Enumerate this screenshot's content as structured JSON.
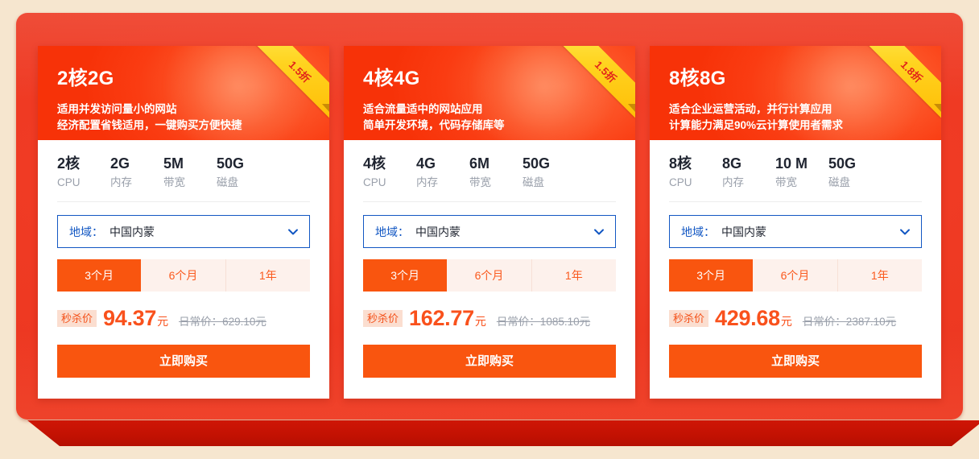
{
  "theme": {
    "page_background": "#f6e6cf",
    "panel_red": "#ef3a23",
    "ribbon_fold_red": "#c21102",
    "card_header_orange": "#fa3c12",
    "accent_orange": "#f9550f",
    "price_orange": "#f9511c",
    "region_blue": "#1257c3",
    "badge_yellow": "#ffd31f",
    "badge_text_red": "#e2241a",
    "muted_gray": "#9aa0ab"
  },
  "common": {
    "region_key": "地域：",
    "region_value": "中国内蒙",
    "chevron_icon": "chevron-down-icon",
    "sale_badge": "秒杀价",
    "price_unit": "元",
    "buy_label": "立即购买",
    "spec_labels": [
      "CPU",
      "内存",
      "带宽",
      "磁盘"
    ],
    "durations": [
      "3个月",
      "6个月",
      "1年"
    ],
    "selected_duration": "3个月"
  },
  "cards": [
    {
      "title": "2核2G",
      "discount_badge": "1.5折",
      "desc_lines": [
        "适用并发访问量小的网站",
        "经济配置省钱适用，一键购买方便快捷"
      ],
      "specs": [
        {
          "value": "2核",
          "label": "CPU"
        },
        {
          "value": "2G",
          "label": "内存"
        },
        {
          "value": "5M",
          "label": "带宽"
        },
        {
          "value": "50G",
          "label": "磁盘"
        }
      ],
      "region_key": "地域：",
      "region_value": "中国内蒙",
      "durations": [
        "3个月",
        "6个月",
        "1年"
      ],
      "selected_duration_index": 0,
      "sale_badge": "秒杀价",
      "price": "94.37",
      "price_unit": "元",
      "original_price": "日常价：629.10元",
      "buy_label": "立即购买"
    },
    {
      "title": "4核4G",
      "discount_badge": "1.5折",
      "desc_lines": [
        "适合流量适中的网站应用",
        "简单开发环境，代码存储库等"
      ],
      "specs": [
        {
          "value": "4核",
          "label": "CPU"
        },
        {
          "value": "4G",
          "label": "内存"
        },
        {
          "value": "6M",
          "label": "带宽"
        },
        {
          "value": "50G",
          "label": "磁盘"
        }
      ],
      "region_key": "地域：",
      "region_value": "中国内蒙",
      "durations": [
        "3个月",
        "6个月",
        "1年"
      ],
      "selected_duration_index": 0,
      "sale_badge": "秒杀价",
      "price": "162.77",
      "price_unit": "元",
      "original_price": "日常价：1085.10元",
      "buy_label": "立即购买"
    },
    {
      "title": "8核8G",
      "discount_badge": "1.8折",
      "desc_lines": [
        "适合企业运营活动，并行计算应用",
        "计算能力满足90%云计算使用者需求"
      ],
      "specs": [
        {
          "value": "8核",
          "label": "CPU"
        },
        {
          "value": "8G",
          "label": "内存"
        },
        {
          "value": "10 M",
          "label": "带宽"
        },
        {
          "value": "50G",
          "label": "磁盘"
        }
      ],
      "region_key": "地域：",
      "region_value": "中国内蒙",
      "durations": [
        "3个月",
        "6个月",
        "1年"
      ],
      "selected_duration_index": 0,
      "sale_badge": "秒杀价",
      "price": "429.68",
      "price_unit": "元",
      "original_price": "日常价：2387.10元",
      "buy_label": "立即购买"
    }
  ]
}
